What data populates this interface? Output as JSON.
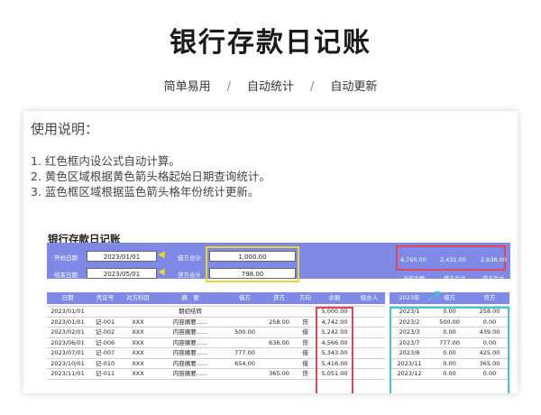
{
  "hero": {
    "title": "银行存款日记账",
    "tags": [
      "简单易用",
      "自动统计",
      "自动更新"
    ],
    "sep": "/"
  },
  "instructions": {
    "heading": "使用说明：",
    "lines": [
      "1. 红色框内设公式自动计算。",
      "2. 黄色区域根据黄色箭头格起始日期查询统计。",
      "3. 蓝色框区域根据蓝色箭头格年份统计更新。"
    ]
  },
  "sheet": {
    "title": "银行存款日记账",
    "start_label": "开始日期",
    "start_value": "2023/01/01",
    "end_label": "结束日期",
    "end_value": "2023/05/01",
    "debit_total_label": "借方合计",
    "debit_total_value": "1,000.00",
    "credit_total_label": "贷方合计",
    "credit_total_value": "798.00",
    "summary": {
      "values": [
        "4,795.00",
        "2,431.00",
        "2,636.00"
      ],
      "labels": [
        "当前余额",
        "借方合计",
        "贷方合计"
      ]
    },
    "columns": [
      "日期",
      "凭证号",
      "对方科目",
      "摘　要",
      "借方",
      "贷方",
      "方向",
      "余额",
      "经办人"
    ],
    "year_columns": [
      "2023年",
      "借方",
      "贷方"
    ],
    "rows": [
      {
        "date": "2023/01/01",
        "voucher": "",
        "account": "",
        "summary": "期初结转",
        "debit": "",
        "credit": "",
        "dir": "",
        "balance": "5,000.00"
      },
      {
        "date": "2023/01/01",
        "voucher": "记-001",
        "account": "XXX",
        "summary": "内容摘要......",
        "debit": "",
        "credit": "258.00",
        "dir": "贷",
        "balance": "4,742.00"
      },
      {
        "date": "2023/02/01",
        "voucher": "记-002",
        "account": "XXX",
        "summary": "内容摘要......",
        "debit": "500.00",
        "credit": "",
        "dir": "借",
        "balance": "5,242.00"
      },
      {
        "date": "2023/06/01",
        "voucher": "记-006",
        "account": "XXX",
        "summary": "内容摘要......",
        "debit": "",
        "credit": "636.00",
        "dir": "贷",
        "balance": "4,566.00"
      },
      {
        "date": "2023/07/01",
        "voucher": "记-007",
        "account": "XXX",
        "summary": "内容摘要......",
        "debit": "777.00",
        "credit": "",
        "dir": "借",
        "balance": "5,343.00"
      },
      {
        "date": "2023/10/01",
        "voucher": "记-010",
        "account": "XXX",
        "summary": "内容摘要......",
        "debit": "654.00",
        "credit": "",
        "dir": "借",
        "balance": "5,416.00"
      },
      {
        "date": "2023/11/01",
        "voucher": "记-011",
        "account": "XXX",
        "summary": "内容摘要......",
        "debit": "",
        "credit": "365.00",
        "dir": "贷",
        "balance": "5,051.00"
      }
    ],
    "year_rows": [
      {
        "month": "2023/1",
        "debit": "0.00",
        "credit": "258.00"
      },
      {
        "month": "2023/2",
        "debit": "500.00",
        "credit": "0.00"
      },
      {
        "month": "2023/3",
        "debit": "0.00",
        "credit": "439.00"
      },
      {
        "month": "2023/7",
        "debit": "777.00",
        "credit": "0.00"
      },
      {
        "month": "2023/8",
        "debit": "0.00",
        "credit": "425.00"
      },
      {
        "month": "2023/11",
        "debit": "0.00",
        "credit": "365.00"
      },
      {
        "month": "2023/12",
        "debit": "0.00",
        "credit": "0.00"
      }
    ]
  }
}
